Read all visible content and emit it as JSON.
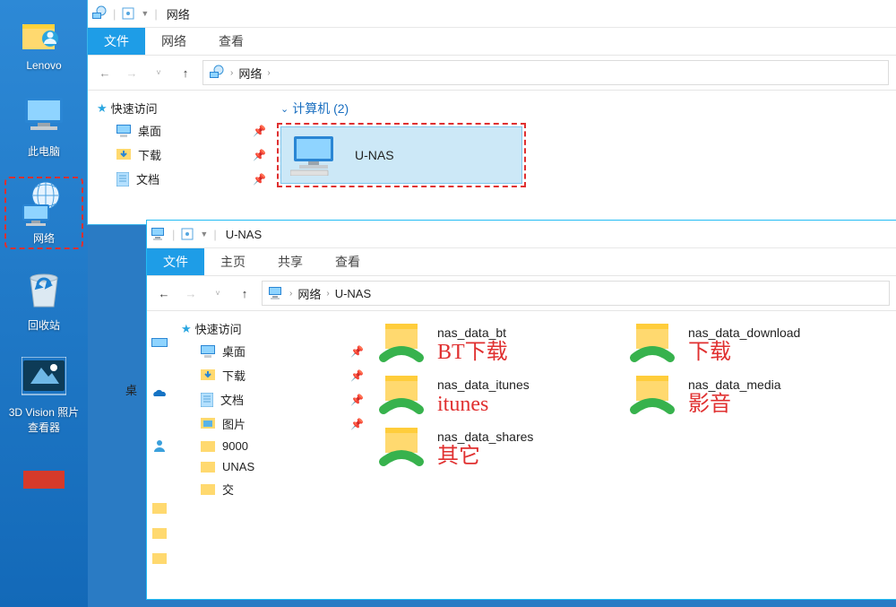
{
  "desktop": {
    "items": [
      {
        "name": "lenovo",
        "label": "Lenovo"
      },
      {
        "name": "this-pc",
        "label": "此电脑"
      },
      {
        "name": "network",
        "label": "网络",
        "highlighted": true
      },
      {
        "name": "recycle",
        "label": "回收站"
      },
      {
        "name": "3dvision",
        "label": "3D Vision 照片查看器"
      }
    ]
  },
  "win1": {
    "title": "网络",
    "tabs": {
      "file": "文件",
      "t1": "网络",
      "t2": "查看"
    },
    "breadcrumb": [
      "网络"
    ],
    "sidebar": {
      "head": "快速访问",
      "items": [
        {
          "icon": "desktop",
          "label": "桌面",
          "pinned": true
        },
        {
          "icon": "download",
          "label": "下载",
          "pinned": true
        },
        {
          "icon": "doc",
          "label": "文档",
          "pinned": true
        }
      ]
    },
    "content": {
      "group_label": "计算机 (2)",
      "computer_name": "U-NAS"
    }
  },
  "win2": {
    "title": "U-NAS",
    "tabs": {
      "file": "文件",
      "t1": "主页",
      "t2": "共享",
      "t3": "查看"
    },
    "breadcrumb": [
      "网络",
      "U-NAS"
    ],
    "sidebar": {
      "head": "快速访问",
      "items": [
        {
          "icon": "desktop",
          "label": "桌面",
          "pinned": true
        },
        {
          "icon": "download",
          "label": "下载",
          "pinned": true
        },
        {
          "icon": "doc",
          "label": "文档",
          "pinned": true
        },
        {
          "icon": "pictures",
          "label": "图片",
          "pinned": true
        },
        {
          "icon": "folder",
          "label": "9000",
          "pinned": false
        },
        {
          "icon": "folder",
          "label": "UNAS",
          "pinned": false
        },
        {
          "icon": "folder",
          "label": "交",
          "pinned": false
        }
      ],
      "extra_truncated": "桌"
    },
    "shares": [
      {
        "name": "nas_data_bt",
        "annotation": "BT下载"
      },
      {
        "name": "nas_data_download",
        "annotation": "下载"
      },
      {
        "name": "nas_data_itunes",
        "annotation": "itunes"
      },
      {
        "name": "nas_data_media",
        "annotation": "影音"
      },
      {
        "name": "nas_data_shares",
        "annotation": "其它"
      }
    ]
  }
}
